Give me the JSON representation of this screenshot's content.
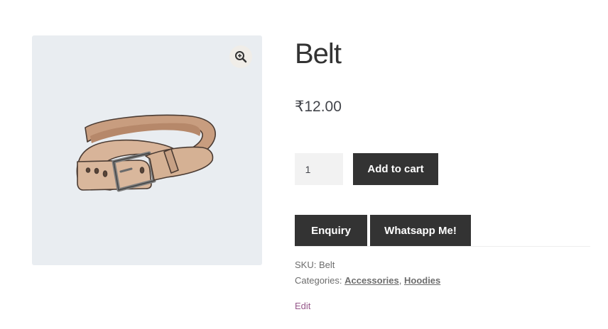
{
  "product": {
    "title": "Belt",
    "price": "₹12.00",
    "quantity": "1",
    "image_alt": "Belt"
  },
  "actions": {
    "add_to_cart": "Add to cart",
    "enquiry": "Enquiry",
    "whatsapp": "Whatsapp Me!"
  },
  "meta": {
    "sku_label": "SKU:",
    "sku_value": "Belt",
    "categories_label": "Categories:",
    "categories": [
      "Accessories",
      "Hoodies"
    ],
    "separator": ","
  },
  "admin": {
    "edit": "Edit"
  },
  "icons": {
    "zoom": "zoom-in-icon"
  },
  "colors": {
    "button_bg": "#333333",
    "gallery_bg": "#e9edf1",
    "edit_link": "#96588a"
  }
}
